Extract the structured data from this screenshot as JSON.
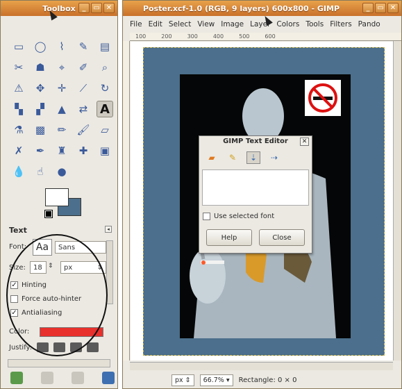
{
  "toolbox": {
    "title": "Toolbox",
    "tools": [
      {
        "name": "rect-select-icon",
        "glyph": "▭"
      },
      {
        "name": "ellipse-select-icon",
        "glyph": "◯"
      },
      {
        "name": "free-select-icon",
        "glyph": "⌇"
      },
      {
        "name": "fuzzy-select-icon",
        "glyph": "✎"
      },
      {
        "name": "color-select-icon",
        "glyph": "▤"
      },
      {
        "name": "scissors-icon",
        "glyph": "✂"
      },
      {
        "name": "foreground-select-icon",
        "glyph": "☗"
      },
      {
        "name": "paths-icon",
        "glyph": "⌖"
      },
      {
        "name": "color-picker-icon",
        "glyph": "✐"
      },
      {
        "name": "zoom-icon",
        "glyph": "⌕"
      },
      {
        "name": "measure-icon",
        "glyph": "⚠"
      },
      {
        "name": "move-icon",
        "glyph": "✥"
      },
      {
        "name": "align-icon",
        "glyph": "✛"
      },
      {
        "name": "crop-icon",
        "glyph": "⟋"
      },
      {
        "name": "rotate-icon",
        "glyph": "↻"
      },
      {
        "name": "scale-icon",
        "glyph": "▚"
      },
      {
        "name": "shear-icon",
        "glyph": "▞"
      },
      {
        "name": "perspective-icon",
        "glyph": "▲"
      },
      {
        "name": "flip-icon",
        "glyph": "⇄"
      },
      {
        "name": "text-icon",
        "glyph": "A"
      },
      {
        "name": "bucket-fill-icon",
        "glyph": "⚗"
      },
      {
        "name": "blend-icon",
        "glyph": "▩"
      },
      {
        "name": "pencil-icon",
        "glyph": "✏"
      },
      {
        "name": "paintbrush-icon",
        "glyph": "🖌"
      },
      {
        "name": "eraser-icon",
        "glyph": "▱"
      },
      {
        "name": "airbrush-icon",
        "glyph": "✗"
      },
      {
        "name": "ink-icon",
        "glyph": "✒"
      },
      {
        "name": "clone-icon",
        "glyph": "♜"
      },
      {
        "name": "heal-icon",
        "glyph": "✚"
      },
      {
        "name": "perspective-clone-icon",
        "glyph": "▣"
      },
      {
        "name": "blur-icon",
        "glyph": "💧"
      },
      {
        "name": "smudge-icon",
        "glyph": "☝"
      },
      {
        "name": "dodge-burn-icon",
        "glyph": "●"
      }
    ],
    "active_tool_index": 19,
    "fg_color": "#ffffff",
    "bg_color": "#4b6f8c",
    "options": {
      "title": "Text",
      "font_label": "Font:",
      "font_preview": "Aa",
      "font_value": "Sans",
      "size_label": "Size:",
      "size_value": "18",
      "unit_value": "px",
      "hinting_label": "Hinting",
      "hinting_checked": "✓",
      "autohint_label": "Force auto-hinter",
      "autohint_checked": "",
      "antialias_label": "Antialiasing",
      "antialias_checked": "✓",
      "color_label": "Color:",
      "text_color": "#e8302c",
      "justify_label": "Justify:"
    }
  },
  "image_window": {
    "title": "Poster.xcf-1.0 (RGB, 9 layers) 600x800 - GIMP",
    "menu": [
      "File",
      "Edit",
      "Select",
      "View",
      "Image",
      "Layer",
      "Colors",
      "Tools",
      "Filters",
      "Pando"
    ],
    "ruler_ticks": [
      "100",
      "200",
      "300",
      "400",
      "500",
      "600"
    ],
    "status": {
      "unit": "px",
      "zoom": "66.7%",
      "tool_info": "Rectangle: 0 × 0"
    }
  },
  "dialog": {
    "title": "GIMP Text Editor",
    "use_font_label": "Use selected font",
    "use_font_checked": "",
    "help_label": "Help",
    "close_label": "Close"
  }
}
